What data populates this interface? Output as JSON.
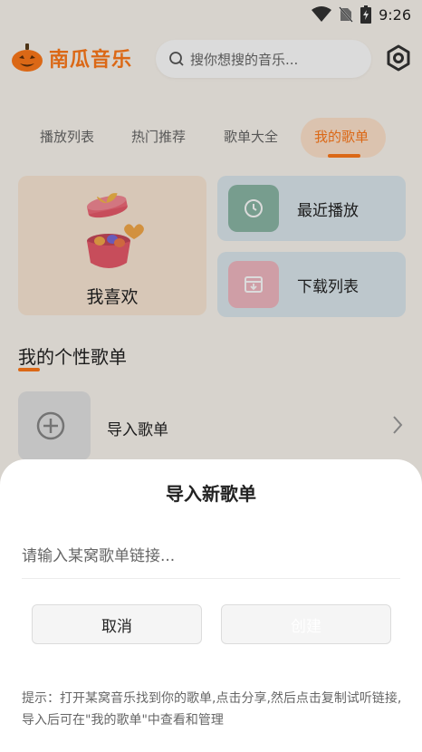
{
  "status_bar": {
    "time": "9:26"
  },
  "header": {
    "app_title": "南瓜音乐",
    "search_placeholder": "搜你想搜的音乐..."
  },
  "tabs": [
    {
      "label": "播放列表",
      "active": false
    },
    {
      "label": "热门推荐",
      "active": false
    },
    {
      "label": "歌单大全",
      "active": false
    },
    {
      "label": "我的歌单",
      "active": true
    }
  ],
  "favorites": {
    "label": "我喜欢"
  },
  "quick_cards": [
    {
      "label": "最近播放",
      "icon": "clock-icon"
    },
    {
      "label": "下载列表",
      "icon": "download-box-icon"
    }
  ],
  "section": {
    "title": "我的个性歌单"
  },
  "import_row": {
    "label": "导入歌单"
  },
  "dialog": {
    "title": "导入新歌单",
    "input_placeholder": "请输入某窝歌单链接...",
    "cancel_label": "取消",
    "create_label": "创建",
    "hint": "提示：打开某窝音乐找到你的歌单,点击分享,然后点击复制试听链接, 导入后可在\"我的歌单\"中查看和管理"
  },
  "colors": {
    "accent": "#ff7a1a",
    "background": "#fbf6ef",
    "favorite_card": "#fbe8d5",
    "quick_card": "#dce8ee"
  }
}
